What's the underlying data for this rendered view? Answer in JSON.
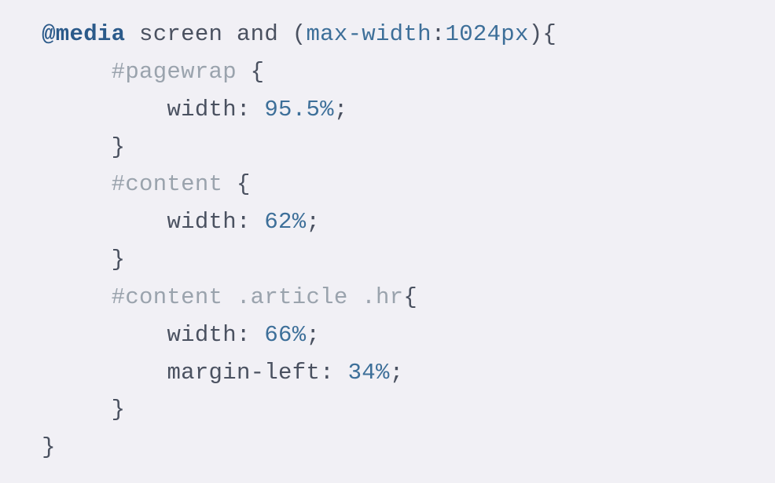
{
  "code": {
    "atrule": "@media",
    "media_type": "screen and",
    "paren_open": "(",
    "media_feature": "max-width",
    "media_colon": ":",
    "media_value": "1024px",
    "paren_close": ")",
    "brace_open": "{",
    "rules": [
      {
        "selector": "#pagewrap",
        "brace_open": "{",
        "declarations": [
          {
            "property": "width",
            "colon": ":",
            "value": "95.5%",
            "semicolon": ";"
          }
        ],
        "brace_close": "}"
      },
      {
        "selector": "#content",
        "brace_open": "{",
        "declarations": [
          {
            "property": "width",
            "colon": ":",
            "value": "62%",
            "semicolon": ";"
          }
        ],
        "brace_close": "}"
      },
      {
        "selector": "#content .article .hr",
        "brace_open": "{",
        "declarations": [
          {
            "property": "width",
            "colon": ":",
            "value": "66%",
            "semicolon": ";"
          },
          {
            "property": "margin-left",
            "colon": ":",
            "value": "34%",
            "semicolon": ";"
          }
        ],
        "brace_close": "}"
      }
    ],
    "brace_close": "}"
  },
  "indent": {
    "lv1": "   ",
    "lv2": "        ",
    "lv3": "            "
  }
}
